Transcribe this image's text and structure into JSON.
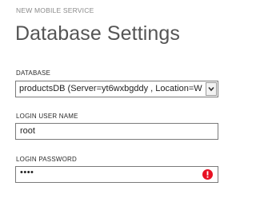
{
  "header": {
    "subtitle": "NEW MOBILE SERVICE",
    "title": "Database Settings"
  },
  "database": {
    "label": "DATABASE",
    "selected_value": "productsDB (Server=yt6wxbgddy , Location=W"
  },
  "login_user_name": {
    "label": "LOGIN USER NAME",
    "value": "root"
  },
  "login_password": {
    "label": "LOGIN PASSWORD",
    "masked_value": "••••",
    "status_icon": "error-exclamation-icon",
    "status_color": "#e81123"
  },
  "colors": {
    "title": "#555555",
    "subtitle": "#8a8a8a",
    "field_border": "#7a7a7a",
    "error": "#e81123"
  }
}
